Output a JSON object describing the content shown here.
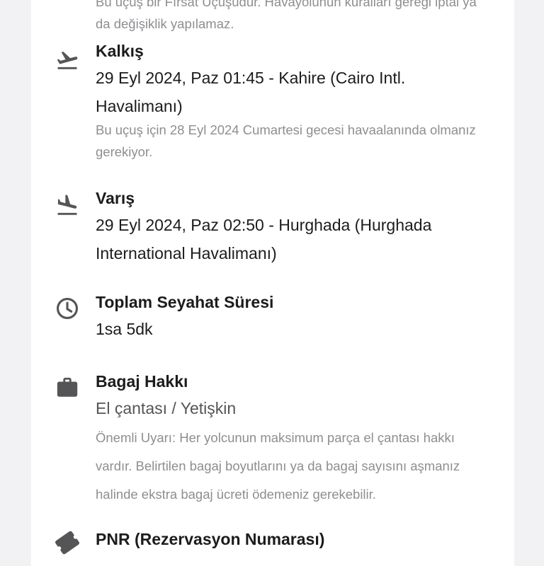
{
  "top_note": "Bu uçuş bir Fırsat Uçuşudur. Havayolunun kuralları gereği iptal ya da değişiklik yapılamaz.",
  "departure": {
    "icon": "airplane-takeoff-icon",
    "title": "Kalkış",
    "value": "29 Eyl 2024, Paz 01:45 - Kahire (Cairo Intl. Havalimanı)",
    "note": "Bu uçuş için 28 Eyl 2024 Cumartesi gecesi havaalanında olmanız gerekiyor."
  },
  "arrival": {
    "icon": "airplane-landing-icon",
    "title": "Varış",
    "value": "29 Eyl 2024, Paz 02:50 - Hurghada (Hurghada International Havalimanı)"
  },
  "duration": {
    "icon": "clock-icon",
    "title": "Toplam Seyahat Süresi",
    "value": "1sa 5dk"
  },
  "baggage": {
    "icon": "briefcase-icon",
    "title": "Bagaj Hakkı",
    "value": "El çantası / Yetişkin",
    "note": "Önemli Uyarı: Her yolcunun maksimum parça el çantası hakkı vardır. Belirtilen bagaj boyutlarını ya da bagaj sayısını aşmanız halinde ekstra bagaj ücreti ödemeniz gerekebilir."
  },
  "pnr": {
    "icon": "ticket-icon",
    "title": "PNR (Rezervasyon Numarası)"
  }
}
